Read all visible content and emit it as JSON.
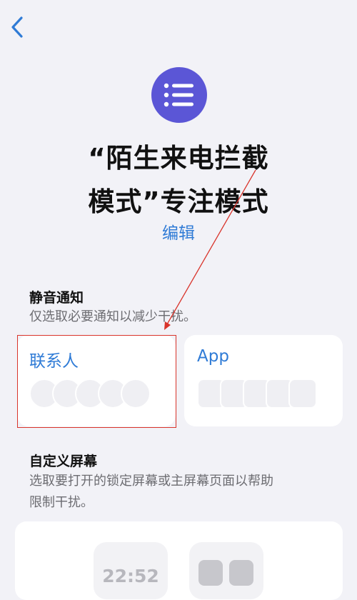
{
  "nav": {
    "back_icon": "chevron-left-icon"
  },
  "focus": {
    "icon": "list-icon",
    "icon_color": "#5b56d6",
    "title_line1": "“陌生来电拦截",
    "title_line2": "模式”专注模式",
    "edit_label": "编辑"
  },
  "silence": {
    "title": "静音通知",
    "description": "仅选取必要通知以减少干扰。",
    "contacts_label": "联系人",
    "apps_label": "App"
  },
  "custom_screen": {
    "title": "自定义屏幕",
    "description_line1": "选取要打开的锁定屏幕或主屏幕页面以帮助",
    "description_line2": "限制干扰。",
    "lock_time": "22:52"
  },
  "colors": {
    "accent": "#2f7bd6",
    "annotation": "#d9342b",
    "background": "#f2f2f7"
  }
}
